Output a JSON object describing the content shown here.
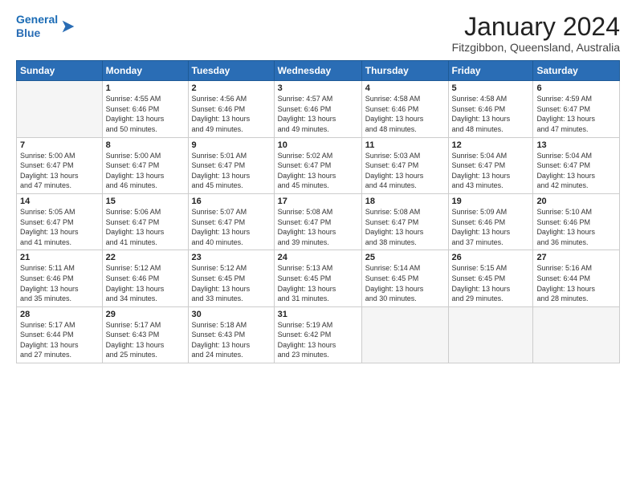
{
  "logo": {
    "line1": "General",
    "line2": "Blue",
    "arrow_color": "#2a6db5"
  },
  "header": {
    "month": "January 2024",
    "location": "Fitzgibbon, Queensland, Australia"
  },
  "weekdays": [
    "Sunday",
    "Monday",
    "Tuesday",
    "Wednesday",
    "Thursday",
    "Friday",
    "Saturday"
  ],
  "weeks": [
    [
      {
        "day": "",
        "info": ""
      },
      {
        "day": "1",
        "info": "Sunrise: 4:55 AM\nSunset: 6:46 PM\nDaylight: 13 hours\nand 50 minutes."
      },
      {
        "day": "2",
        "info": "Sunrise: 4:56 AM\nSunset: 6:46 PM\nDaylight: 13 hours\nand 49 minutes."
      },
      {
        "day": "3",
        "info": "Sunrise: 4:57 AM\nSunset: 6:46 PM\nDaylight: 13 hours\nand 49 minutes."
      },
      {
        "day": "4",
        "info": "Sunrise: 4:58 AM\nSunset: 6:46 PM\nDaylight: 13 hours\nand 48 minutes."
      },
      {
        "day": "5",
        "info": "Sunrise: 4:58 AM\nSunset: 6:46 PM\nDaylight: 13 hours\nand 48 minutes."
      },
      {
        "day": "6",
        "info": "Sunrise: 4:59 AM\nSunset: 6:47 PM\nDaylight: 13 hours\nand 47 minutes."
      }
    ],
    [
      {
        "day": "7",
        "info": "Sunrise: 5:00 AM\nSunset: 6:47 PM\nDaylight: 13 hours\nand 47 minutes."
      },
      {
        "day": "8",
        "info": "Sunrise: 5:00 AM\nSunset: 6:47 PM\nDaylight: 13 hours\nand 46 minutes."
      },
      {
        "day": "9",
        "info": "Sunrise: 5:01 AM\nSunset: 6:47 PM\nDaylight: 13 hours\nand 45 minutes."
      },
      {
        "day": "10",
        "info": "Sunrise: 5:02 AM\nSunset: 6:47 PM\nDaylight: 13 hours\nand 45 minutes."
      },
      {
        "day": "11",
        "info": "Sunrise: 5:03 AM\nSunset: 6:47 PM\nDaylight: 13 hours\nand 44 minutes."
      },
      {
        "day": "12",
        "info": "Sunrise: 5:04 AM\nSunset: 6:47 PM\nDaylight: 13 hours\nand 43 minutes."
      },
      {
        "day": "13",
        "info": "Sunrise: 5:04 AM\nSunset: 6:47 PM\nDaylight: 13 hours\nand 42 minutes."
      }
    ],
    [
      {
        "day": "14",
        "info": "Sunrise: 5:05 AM\nSunset: 6:47 PM\nDaylight: 13 hours\nand 41 minutes."
      },
      {
        "day": "15",
        "info": "Sunrise: 5:06 AM\nSunset: 6:47 PM\nDaylight: 13 hours\nand 41 minutes."
      },
      {
        "day": "16",
        "info": "Sunrise: 5:07 AM\nSunset: 6:47 PM\nDaylight: 13 hours\nand 40 minutes."
      },
      {
        "day": "17",
        "info": "Sunrise: 5:08 AM\nSunset: 6:47 PM\nDaylight: 13 hours\nand 39 minutes."
      },
      {
        "day": "18",
        "info": "Sunrise: 5:08 AM\nSunset: 6:47 PM\nDaylight: 13 hours\nand 38 minutes."
      },
      {
        "day": "19",
        "info": "Sunrise: 5:09 AM\nSunset: 6:46 PM\nDaylight: 13 hours\nand 37 minutes."
      },
      {
        "day": "20",
        "info": "Sunrise: 5:10 AM\nSunset: 6:46 PM\nDaylight: 13 hours\nand 36 minutes."
      }
    ],
    [
      {
        "day": "21",
        "info": "Sunrise: 5:11 AM\nSunset: 6:46 PM\nDaylight: 13 hours\nand 35 minutes."
      },
      {
        "day": "22",
        "info": "Sunrise: 5:12 AM\nSunset: 6:46 PM\nDaylight: 13 hours\nand 34 minutes."
      },
      {
        "day": "23",
        "info": "Sunrise: 5:12 AM\nSunset: 6:45 PM\nDaylight: 13 hours\nand 33 minutes."
      },
      {
        "day": "24",
        "info": "Sunrise: 5:13 AM\nSunset: 6:45 PM\nDaylight: 13 hours\nand 31 minutes."
      },
      {
        "day": "25",
        "info": "Sunrise: 5:14 AM\nSunset: 6:45 PM\nDaylight: 13 hours\nand 30 minutes."
      },
      {
        "day": "26",
        "info": "Sunrise: 5:15 AM\nSunset: 6:45 PM\nDaylight: 13 hours\nand 29 minutes."
      },
      {
        "day": "27",
        "info": "Sunrise: 5:16 AM\nSunset: 6:44 PM\nDaylight: 13 hours\nand 28 minutes."
      }
    ],
    [
      {
        "day": "28",
        "info": "Sunrise: 5:17 AM\nSunset: 6:44 PM\nDaylight: 13 hours\nand 27 minutes."
      },
      {
        "day": "29",
        "info": "Sunrise: 5:17 AM\nSunset: 6:43 PM\nDaylight: 13 hours\nand 25 minutes."
      },
      {
        "day": "30",
        "info": "Sunrise: 5:18 AM\nSunset: 6:43 PM\nDaylight: 13 hours\nand 24 minutes."
      },
      {
        "day": "31",
        "info": "Sunrise: 5:19 AM\nSunset: 6:42 PM\nDaylight: 13 hours\nand 23 minutes."
      },
      {
        "day": "",
        "info": ""
      },
      {
        "day": "",
        "info": ""
      },
      {
        "day": "",
        "info": ""
      }
    ]
  ]
}
